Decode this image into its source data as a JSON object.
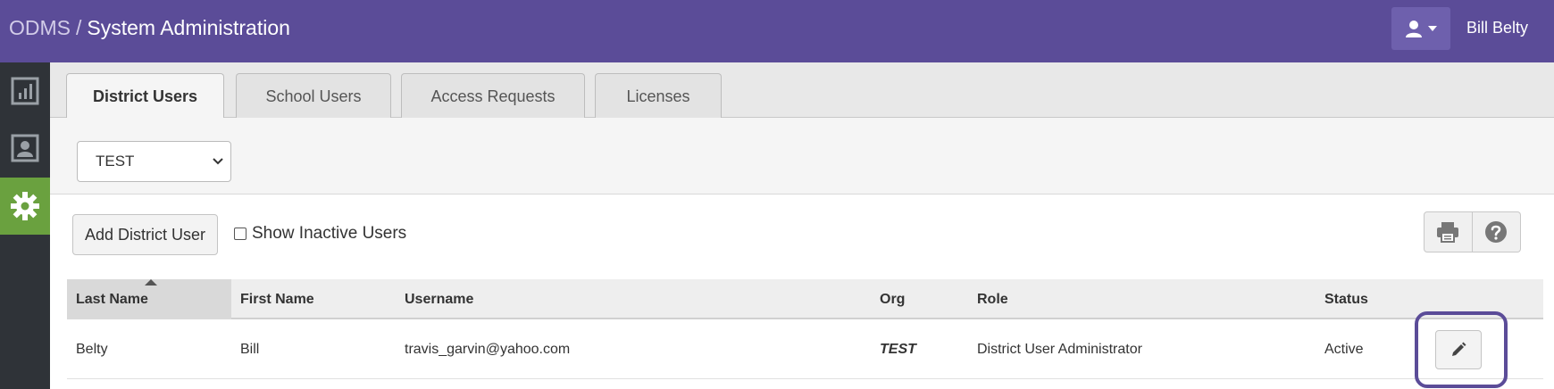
{
  "header": {
    "app_name": "ODMS",
    "separator": "/",
    "page_title": "System Administration",
    "user_name": "Bill Belty"
  },
  "sidebar": {
    "items": [
      {
        "icon": "bar-chart-icon"
      },
      {
        "icon": "user-profile-icon"
      },
      {
        "icon": "gear-icon",
        "active": true
      }
    ]
  },
  "tabs": [
    {
      "label": "District Users",
      "active": true
    },
    {
      "label": "School Users"
    },
    {
      "label": "Access Requests"
    },
    {
      "label": "Licenses"
    }
  ],
  "filter": {
    "org_selected": "TEST"
  },
  "toolbar": {
    "add_label": "Add District User",
    "show_inactive_label": "Show Inactive Users",
    "show_inactive_checked": false
  },
  "table": {
    "columns": [
      "Last Name",
      "First Name",
      "Username",
      "Org",
      "Role",
      "Status"
    ],
    "sorted_column": "Last Name",
    "rows": [
      {
        "last_name": "Belty",
        "first_name": "Bill",
        "username": "travis_garvin@yahoo.com",
        "org": "TEST",
        "role": "District User Administrator",
        "status": "Active"
      }
    ]
  },
  "colors": {
    "header_bg": "#5b4c98",
    "sidebar_bg": "#2f3338",
    "sidebar_active": "#6aa13f",
    "highlight": "#5b4c98"
  }
}
